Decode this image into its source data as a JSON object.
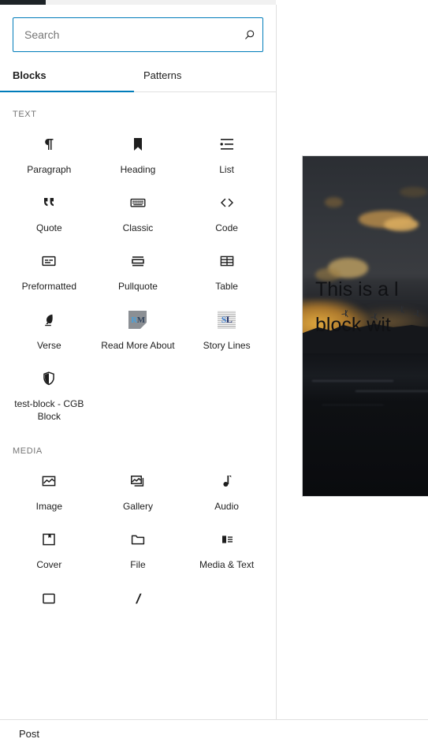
{
  "search": {
    "placeholder": "Search",
    "value": "",
    "icon": "search-icon"
  },
  "tabs": [
    {
      "label": "Blocks",
      "active": true
    },
    {
      "label": "Patterns",
      "active": false
    }
  ],
  "sections": [
    {
      "title": "TEXT",
      "blocks": [
        {
          "label": "Paragraph",
          "icon": "paragraph-icon"
        },
        {
          "label": "Heading",
          "icon": "heading-icon"
        },
        {
          "label": "List",
          "icon": "list-icon"
        },
        {
          "label": "Quote",
          "icon": "quote-icon"
        },
        {
          "label": "Classic",
          "icon": "classic-keyboard-icon"
        },
        {
          "label": "Code",
          "icon": "code-icon"
        },
        {
          "label": "Preformatted",
          "icon": "preformatted-icon"
        },
        {
          "label": "Pullquote",
          "icon": "pullquote-icon"
        },
        {
          "label": "Table",
          "icon": "table-icon"
        },
        {
          "label": "Verse",
          "icon": "verse-quill-icon"
        },
        {
          "label": "Read More About",
          "icon": "read-more-about-icon"
        },
        {
          "label": "Story Lines",
          "icon": "story-lines-icon"
        },
        {
          "label": "test-block - CGB Block",
          "icon": "shield-icon"
        }
      ]
    },
    {
      "title": "MEDIA",
      "blocks": [
        {
          "label": "Image",
          "icon": "image-icon"
        },
        {
          "label": "Gallery",
          "icon": "gallery-icon"
        },
        {
          "label": "Audio",
          "icon": "audio-note-icon"
        },
        {
          "label": "Cover",
          "icon": "cover-icon"
        },
        {
          "label": "File",
          "icon": "file-folder-icon"
        },
        {
          "label": "Media & Text",
          "icon": "media-and-text-icon"
        }
      ]
    }
  ],
  "statusbar": {
    "label": "Post"
  },
  "canvas": {
    "cover_block": {
      "text_line_1": "This is a l",
      "text_line_2": "block wit"
    }
  },
  "colors": {
    "accent": "#007cba",
    "panel_border": "#e0e0e0",
    "text": "#1e1e1e",
    "muted_text": "#757575",
    "adminbar": "#1d2327"
  },
  "icon_tiles": {
    "read_more": {
      "first": "R",
      "second": "M"
    },
    "story_lines": {
      "first": "S",
      "second": "L"
    }
  }
}
